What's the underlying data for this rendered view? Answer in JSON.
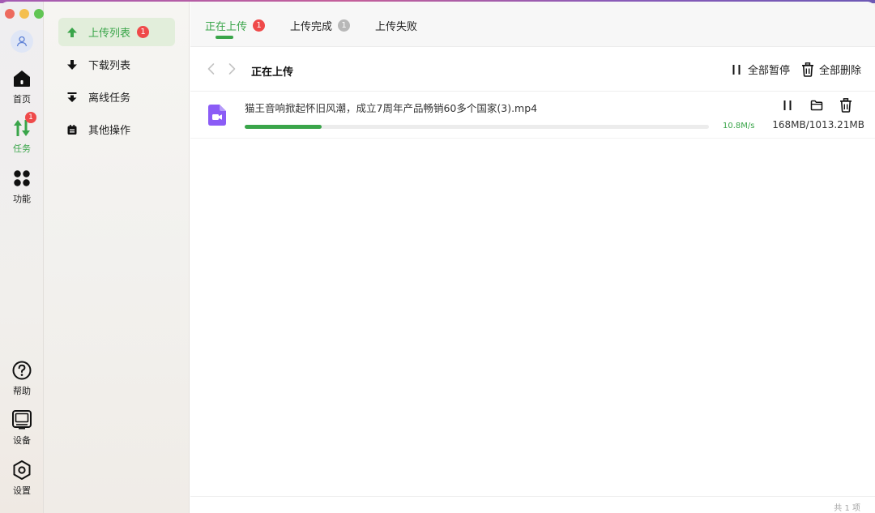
{
  "colors": {
    "accent": "#3aa54a",
    "badge": "#ef4a4a",
    "grey_badge": "#b8b8b8",
    "file_icon": "#8b5cf6"
  },
  "rail": {
    "items": [
      {
        "label": "首页",
        "icon": "home-icon"
      },
      {
        "label": "任务",
        "icon": "transfer-icon",
        "badge": "1"
      },
      {
        "label": "功能",
        "icon": "apps-grid-icon"
      },
      {
        "label": "帮助",
        "icon": "help-icon"
      },
      {
        "label": "设备",
        "icon": "device-icon"
      },
      {
        "label": "设置",
        "icon": "settings-icon"
      }
    ]
  },
  "sidebar": {
    "items": [
      {
        "label": "上传列表",
        "icon": "upload-arrow-icon",
        "badge": "1"
      },
      {
        "label": "下载列表",
        "icon": "download-arrow-icon"
      },
      {
        "label": "离线任务",
        "icon": "offline-download-icon"
      },
      {
        "label": "其他操作",
        "icon": "other-ops-icon"
      }
    ]
  },
  "tabs": [
    {
      "label": "正在上传",
      "badge": "1"
    },
    {
      "label": "上传完成",
      "badge": "1"
    },
    {
      "label": "上传失败"
    }
  ],
  "toolbar": {
    "title": "正在上传",
    "pause_all": "全部暂停",
    "delete_all": "全部删除"
  },
  "tasks": [
    {
      "name": "猫王音响掀起怀旧风潮，成立7周年产品畅销60多个国家(3).mp4",
      "speed": "10.8M/s",
      "size": "168MB/1013.21MB",
      "progress": 0.166
    }
  ],
  "footer": {
    "total": "共 1 项"
  }
}
